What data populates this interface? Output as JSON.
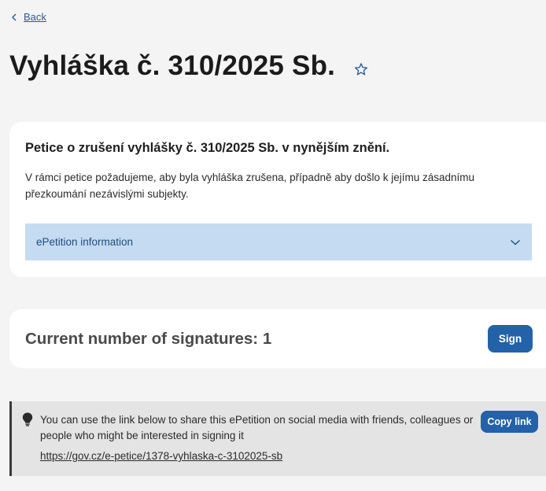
{
  "nav": {
    "back_label": "Back"
  },
  "page": {
    "title": "Vyhláška č. 310/2025 Sb."
  },
  "petition": {
    "heading": "Petice o zrušení vyhlášky č. 310/2025 Sb. v nynějším znění.",
    "description": "V rámci petice požadujeme, aby byla vyhláška zrušena, případně aby došlo k jejímu zásadnímu přezkoumání nezávislými subjekty.",
    "accordion_label": "ePetition information"
  },
  "signatures": {
    "label": "Current number of signatures: 1",
    "sign_button": "Sign"
  },
  "share": {
    "text": "You can use the link below to share this ePetition on social media with friends, colleagues or people who might be interested in signing it",
    "link": "https://gov.cz/e-petice/1378-vyhlaska-c-3102025-sb",
    "copy_button": "Copy link"
  },
  "colors": {
    "accent": "#2362a8",
    "accordion_bg": "#c5dbf1",
    "page_bg": "#f4f4f4"
  },
  "icons": [
    "chevron-left-icon",
    "star-outline-icon",
    "chevron-down-icon",
    "lightbulb-icon"
  ]
}
